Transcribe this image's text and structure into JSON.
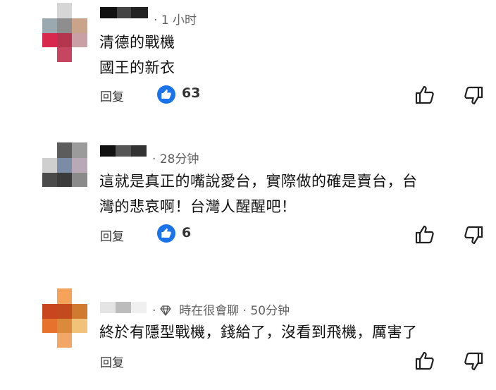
{
  "comments": [
    {
      "timestamp": "1 小时",
      "lines": [
        "清德的戰機",
        "國王的新衣"
      ],
      "reply_label": "回复",
      "like_count": "63"
    },
    {
      "timestamp": "28分钟",
      "lines": [
        "這就是真正的嘴說愛台，實際做的確是賣台，台",
        "灣的悲哀啊！台灣人醒醒吧！"
      ],
      "reply_label": "回复",
      "like_count": "6"
    },
    {
      "username": "時在很會聊",
      "timestamp": "50分钟",
      "lines": [
        "終於有隱型戰機，錢給了，沒看到飛機，厲害了"
      ],
      "reply_label": "回复"
    }
  ],
  "meta_separator": "·",
  "icons": {
    "like_badge": "thumbs-up-icon",
    "like_button": "thumbs-up-outline-icon",
    "dislike_button": "thumbs-down-outline-icon",
    "member_badge": "diamond-icon"
  },
  "colors": {
    "accent": "#1a73e8",
    "meta_text": "#606060"
  }
}
